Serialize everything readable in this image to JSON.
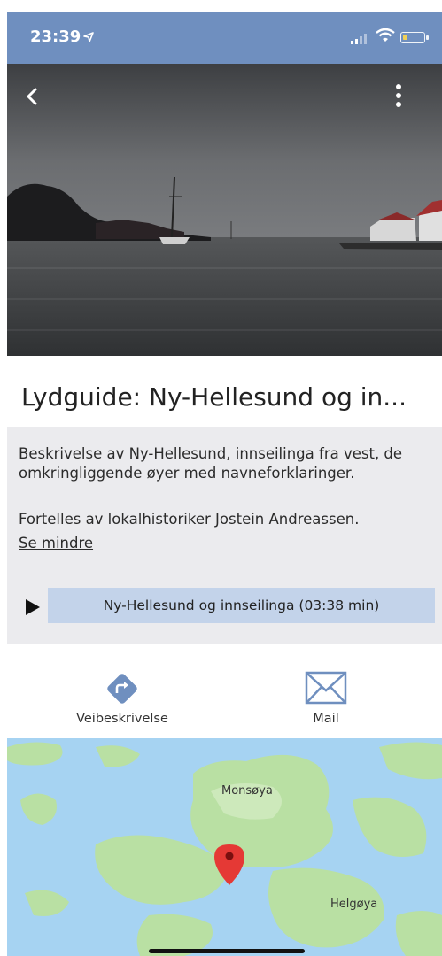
{
  "status_bar": {
    "time": "23:39"
  },
  "content": {
    "title": "Lydguide: Ny-Hellesund og in...",
    "description": "Beskrivelse av Ny-Hellesund, innseilinga fra vest, de omkringliggende øyer med navneforklaringer.",
    "narrator": "Fortelles av lokalhistoriker Jostein Andreassen.",
    "see_less": "Se mindre",
    "audio_track_label": "Ny-Hellesund og innseilinga (03:38 min)"
  },
  "actions": {
    "directions_label": "Veibeskrivelse",
    "mail_label": "Mail"
  },
  "map": {
    "places": [
      "Monsøya",
      "Helgøya"
    ]
  },
  "colors": {
    "status_bar": "#6f8fbf",
    "description_bg": "#ebebee",
    "audio_track_bg": "#c3d3ea",
    "icon_blue": "#6f8fbf",
    "water": "#a6d3f2",
    "land": "#b9e0a3",
    "pin": "#e53935"
  },
  "icons": [
    "location-arrow-icon",
    "signal-icon",
    "wifi-icon",
    "battery-icon",
    "back-chevron-icon",
    "more-vertical-icon",
    "play-icon",
    "directions-icon",
    "mail-icon",
    "map-pin-icon"
  ]
}
